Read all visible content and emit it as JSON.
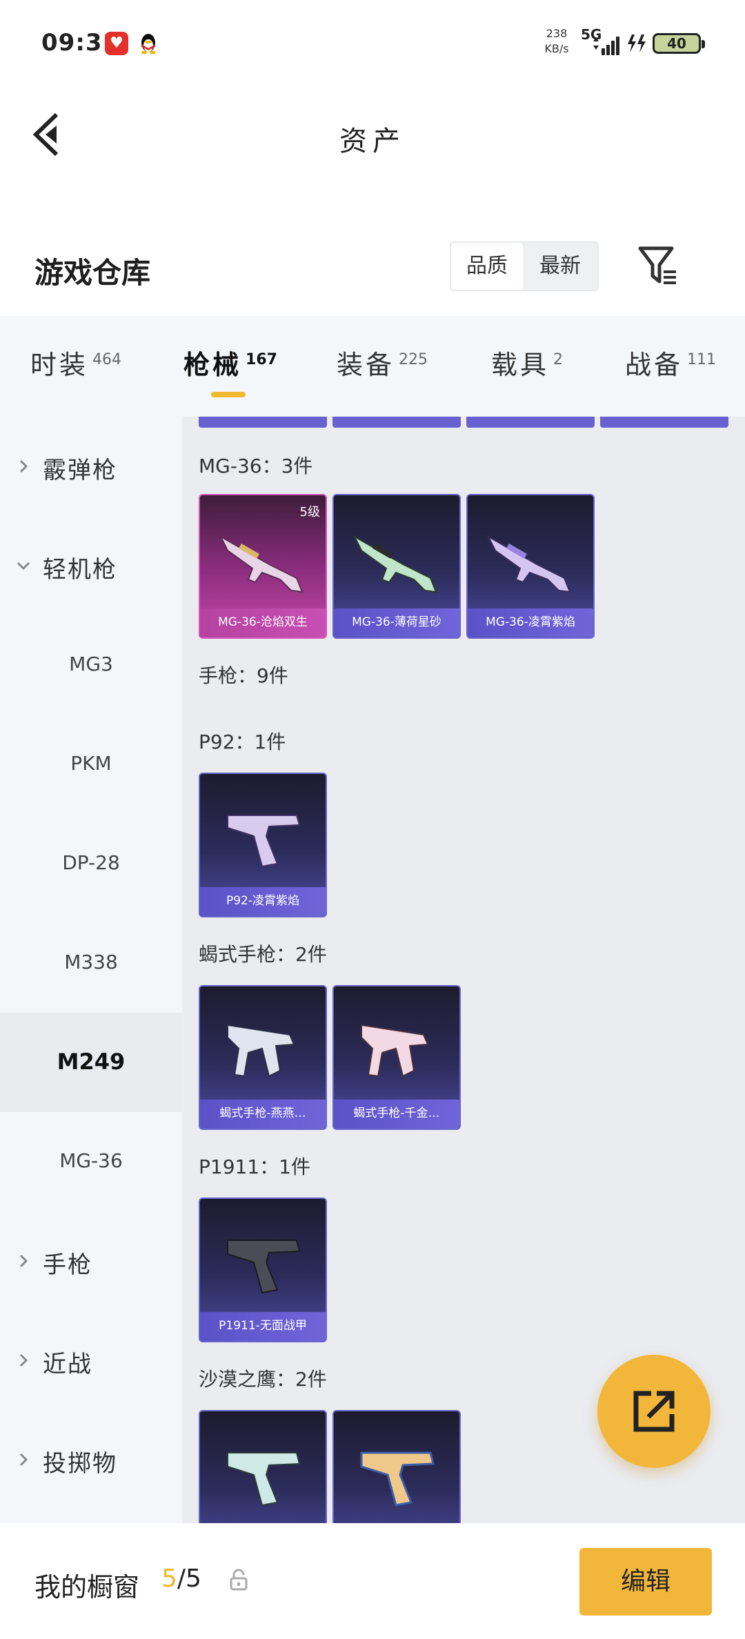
{
  "status_bar": {
    "time": "09:31",
    "net_speed_value": "238",
    "net_speed_unit": "KB/s",
    "network": "5G",
    "battery": "40"
  },
  "header": {
    "title": "资产"
  },
  "warehouse": {
    "title": "游戏仓库",
    "sort_options": [
      "品质",
      "最新"
    ]
  },
  "tabs": [
    {
      "label": "时装",
      "count": "464"
    },
    {
      "label": "枪械",
      "count": "167"
    },
    {
      "label": "装备",
      "count": "225"
    },
    {
      "label": "载具",
      "count": "2"
    },
    {
      "label": "战备",
      "count": "111"
    }
  ],
  "sidebar": {
    "items": [
      {
        "label": "霰弹枪"
      },
      {
        "label": "轻机枪"
      },
      {
        "label": "MG3"
      },
      {
        "label": "PKM"
      },
      {
        "label": "DP-28"
      },
      {
        "label": "M338"
      },
      {
        "label": "M249"
      },
      {
        "label": "MG-36"
      },
      {
        "label": "手枪"
      },
      {
        "label": "近战"
      },
      {
        "label": "投掷物"
      }
    ]
  },
  "content": {
    "groups": [
      {
        "title": "MG-36：3件",
        "items": [
          {
            "name": "MG-36-沧焰双生",
            "level": "5级"
          },
          {
            "name": "MG-36-薄荷星砂"
          },
          {
            "name": "MG-36-凌霄紫焰"
          }
        ]
      },
      {
        "title": "手枪：9件"
      },
      {
        "title": "P92：1件",
        "items": [
          {
            "name": "P92-凌霄紫焰"
          }
        ]
      },
      {
        "title": "蝎式手枪：2件",
        "items": [
          {
            "name": "蝎式手枪-燕燕…"
          },
          {
            "name": "蝎式手枪-千金…"
          }
        ]
      },
      {
        "title": "P1911：1件",
        "items": [
          {
            "name": "P1911-无面战甲"
          }
        ]
      },
      {
        "title": "沙漠之鹰：2件"
      }
    ]
  },
  "bottom_bar": {
    "label": "我的橱窗",
    "current": "5",
    "separator": "/",
    "total": "5",
    "edit_label": "编辑"
  },
  "colors": {
    "accent": "#f2b63a",
    "card_purple": "#6a66c8",
    "card_pink": "#d356b8"
  }
}
